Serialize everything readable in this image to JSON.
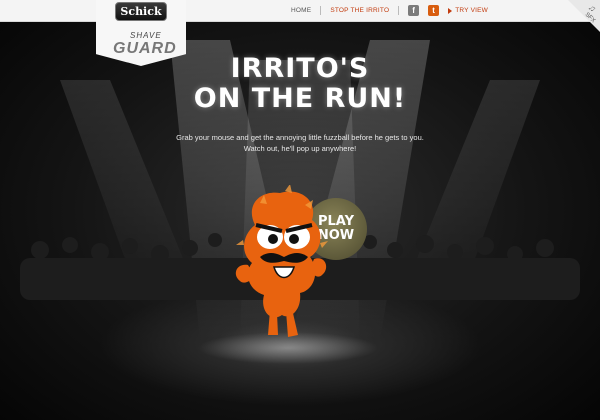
{
  "header": {
    "logo_text": "Schick",
    "shave_text": "SHAVE",
    "guard_text": "GUARD",
    "nav_home": "HOME",
    "nav_stop": "STOP THE IRRITO",
    "facebook_glyph": "f",
    "twitter_glyph": "t",
    "try_view": "TRY VIEW",
    "corner_icon": "speaker-icon",
    "corner_label": "SFX"
  },
  "main": {
    "title_line1": "IRRITO'S",
    "title_line2": "ON THE RUN!",
    "desc_line1": "Grab your mouse and get the annoying little fuzzball before he gets to you.",
    "desc_line2": "Watch out, he'll pop up anywhere!",
    "play_line1": "PLAY",
    "play_line2": "NOW"
  },
  "colors": {
    "accent": "#d85d10",
    "nav_highlight": "#c23b0e",
    "creature_orange": "#e8630f",
    "play_bg": "#6d6845",
    "topbar_bg": "#f4f4f4"
  }
}
